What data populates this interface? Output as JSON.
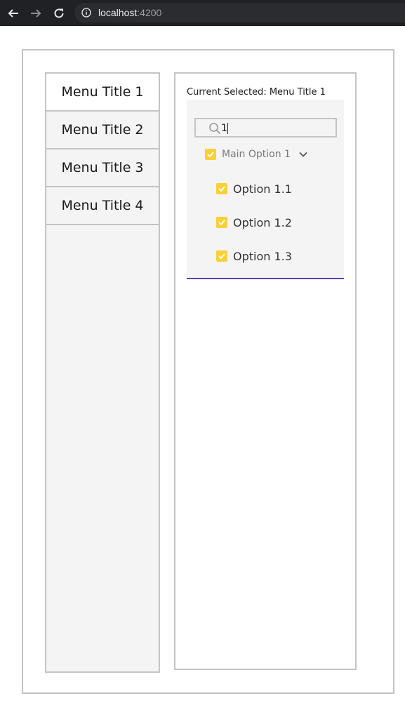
{
  "browser": {
    "url_host": "localhost",
    "url_port": ":4200"
  },
  "menu": {
    "items": [
      {
        "label": "Menu Title 1",
        "active": true
      },
      {
        "label": "Menu Title 2",
        "active": false
      },
      {
        "label": "Menu Title 3",
        "active": false
      },
      {
        "label": "Menu Title 4",
        "active": false
      }
    ]
  },
  "content": {
    "current_selected": "Current Selected: Menu Title 1",
    "search": {
      "value": "1"
    },
    "main_option": {
      "label": "Main Option 1",
      "checked": true,
      "expanded": true
    },
    "sub_options": [
      {
        "label": "Option 1.1",
        "checked": true
      },
      {
        "label": "Option 1.2",
        "checked": true
      },
      {
        "label": "Option 1.3",
        "checked": true
      }
    ]
  },
  "colors": {
    "checkbox": "#f7d137",
    "underline": "#5a3fb0",
    "border": "#c4c4c4",
    "panel_bg": "#f4f4f4",
    "chrome_bg": "#202124"
  },
  "icons": [
    "back-arrow-icon",
    "forward-arrow-icon",
    "reload-icon",
    "info-icon",
    "search-icon",
    "check-icon",
    "chevron-down-icon"
  ]
}
